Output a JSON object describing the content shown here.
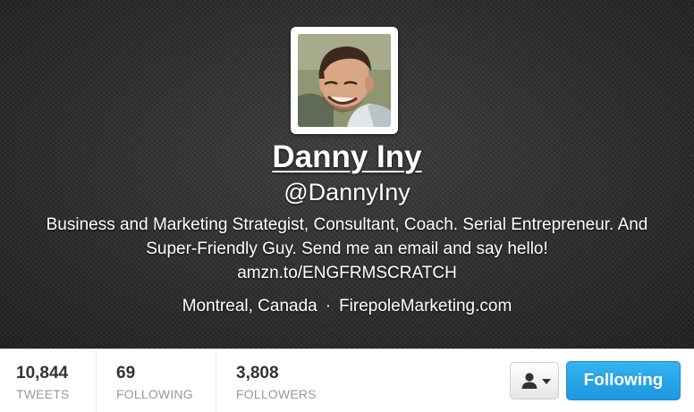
{
  "profile": {
    "name": "Danny Iny",
    "handle": "@DannyIny",
    "bio": "Business and Marketing Strategist, Consultant, Coach. Serial Entrepreneur. And Super-Friendly Guy. Send me an email and say hello! amzn.to/ENGFRMSCRATCH",
    "location": "Montreal, Canada",
    "separator": "·",
    "website": "FirepoleMarketing.com",
    "avatar_icon": "profile-photo"
  },
  "stats": {
    "tweets": {
      "count": "10,844",
      "label": "TWEETS"
    },
    "following": {
      "count": "69",
      "label": "FOLLOWING"
    },
    "followers": {
      "count": "3,808",
      "label": "FOLLOWERS"
    }
  },
  "actions": {
    "user_menu_icon": "user-icon",
    "user_menu_caret": "caret-down-icon",
    "follow_button_label": "Following"
  },
  "colors": {
    "header_background": "#2f2f2f",
    "follow_button": "#2aa9e8",
    "stat_count": "#333333",
    "stat_label": "#999999"
  }
}
